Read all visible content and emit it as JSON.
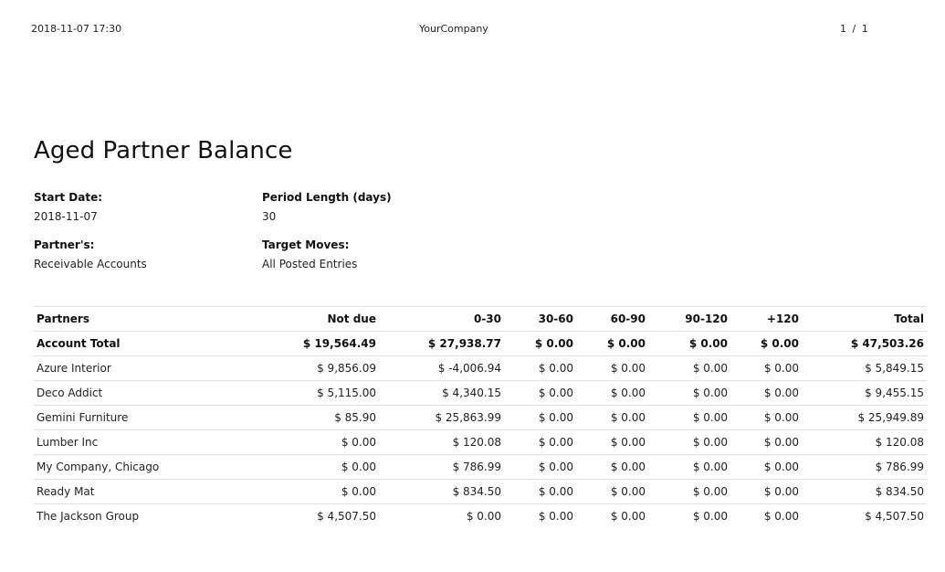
{
  "header": {
    "datetime": "2018-11-07 17:30",
    "company": "YourCompany",
    "pager": "1 / 1"
  },
  "report": {
    "title": "Aged Partner Balance",
    "start_date_label": "Start Date:",
    "start_date": "2018-11-07",
    "period_length_label": "Period Length (days)",
    "period_length": "30",
    "partners_label": "Partner's:",
    "partners": "Receivable Accounts",
    "target_moves_label": "Target Moves:",
    "target_moves": "All Posted Entries"
  },
  "table": {
    "columns": [
      "Partners",
      "Not due",
      "0-30",
      "30-60",
      "60-90",
      "90-120",
      "+120",
      "Total"
    ],
    "total_row": [
      "Account Total",
      "$ 19,564.49",
      "$ 27,938.77",
      "$ 0.00",
      "$ 0.00",
      "$ 0.00",
      "$ 0.00",
      "$ 47,503.26"
    ],
    "rows": [
      [
        "Azure Interior",
        "$ 9,856.09",
        "$ -4,006.94",
        "$ 0.00",
        "$ 0.00",
        "$ 0.00",
        "$ 0.00",
        "$ 5,849.15"
      ],
      [
        "Deco Addict",
        "$ 5,115.00",
        "$ 4,340.15",
        "$ 0.00",
        "$ 0.00",
        "$ 0.00",
        "$ 0.00",
        "$ 9,455.15"
      ],
      [
        "Gemini Furniture",
        "$ 85.90",
        "$ 25,863.99",
        "$ 0.00",
        "$ 0.00",
        "$ 0.00",
        "$ 0.00",
        "$ 25,949.89"
      ],
      [
        "Lumber Inc",
        "$ 0.00",
        "$ 120.08",
        "$ 0.00",
        "$ 0.00",
        "$ 0.00",
        "$ 0.00",
        "$ 120.08"
      ],
      [
        "My Company, Chicago",
        "$ 0.00",
        "$ 786.99",
        "$ 0.00",
        "$ 0.00",
        "$ 0.00",
        "$ 0.00",
        "$ 786.99"
      ],
      [
        "Ready Mat",
        "$ 0.00",
        "$ 834.50",
        "$ 0.00",
        "$ 0.00",
        "$ 0.00",
        "$ 0.00",
        "$ 834.50"
      ],
      [
        "The Jackson Group",
        "$ 4,507.50",
        "$ 0.00",
        "$ 0.00",
        "$ 0.00",
        "$ 0.00",
        "$ 0.00",
        "$ 4,507.50"
      ]
    ]
  }
}
